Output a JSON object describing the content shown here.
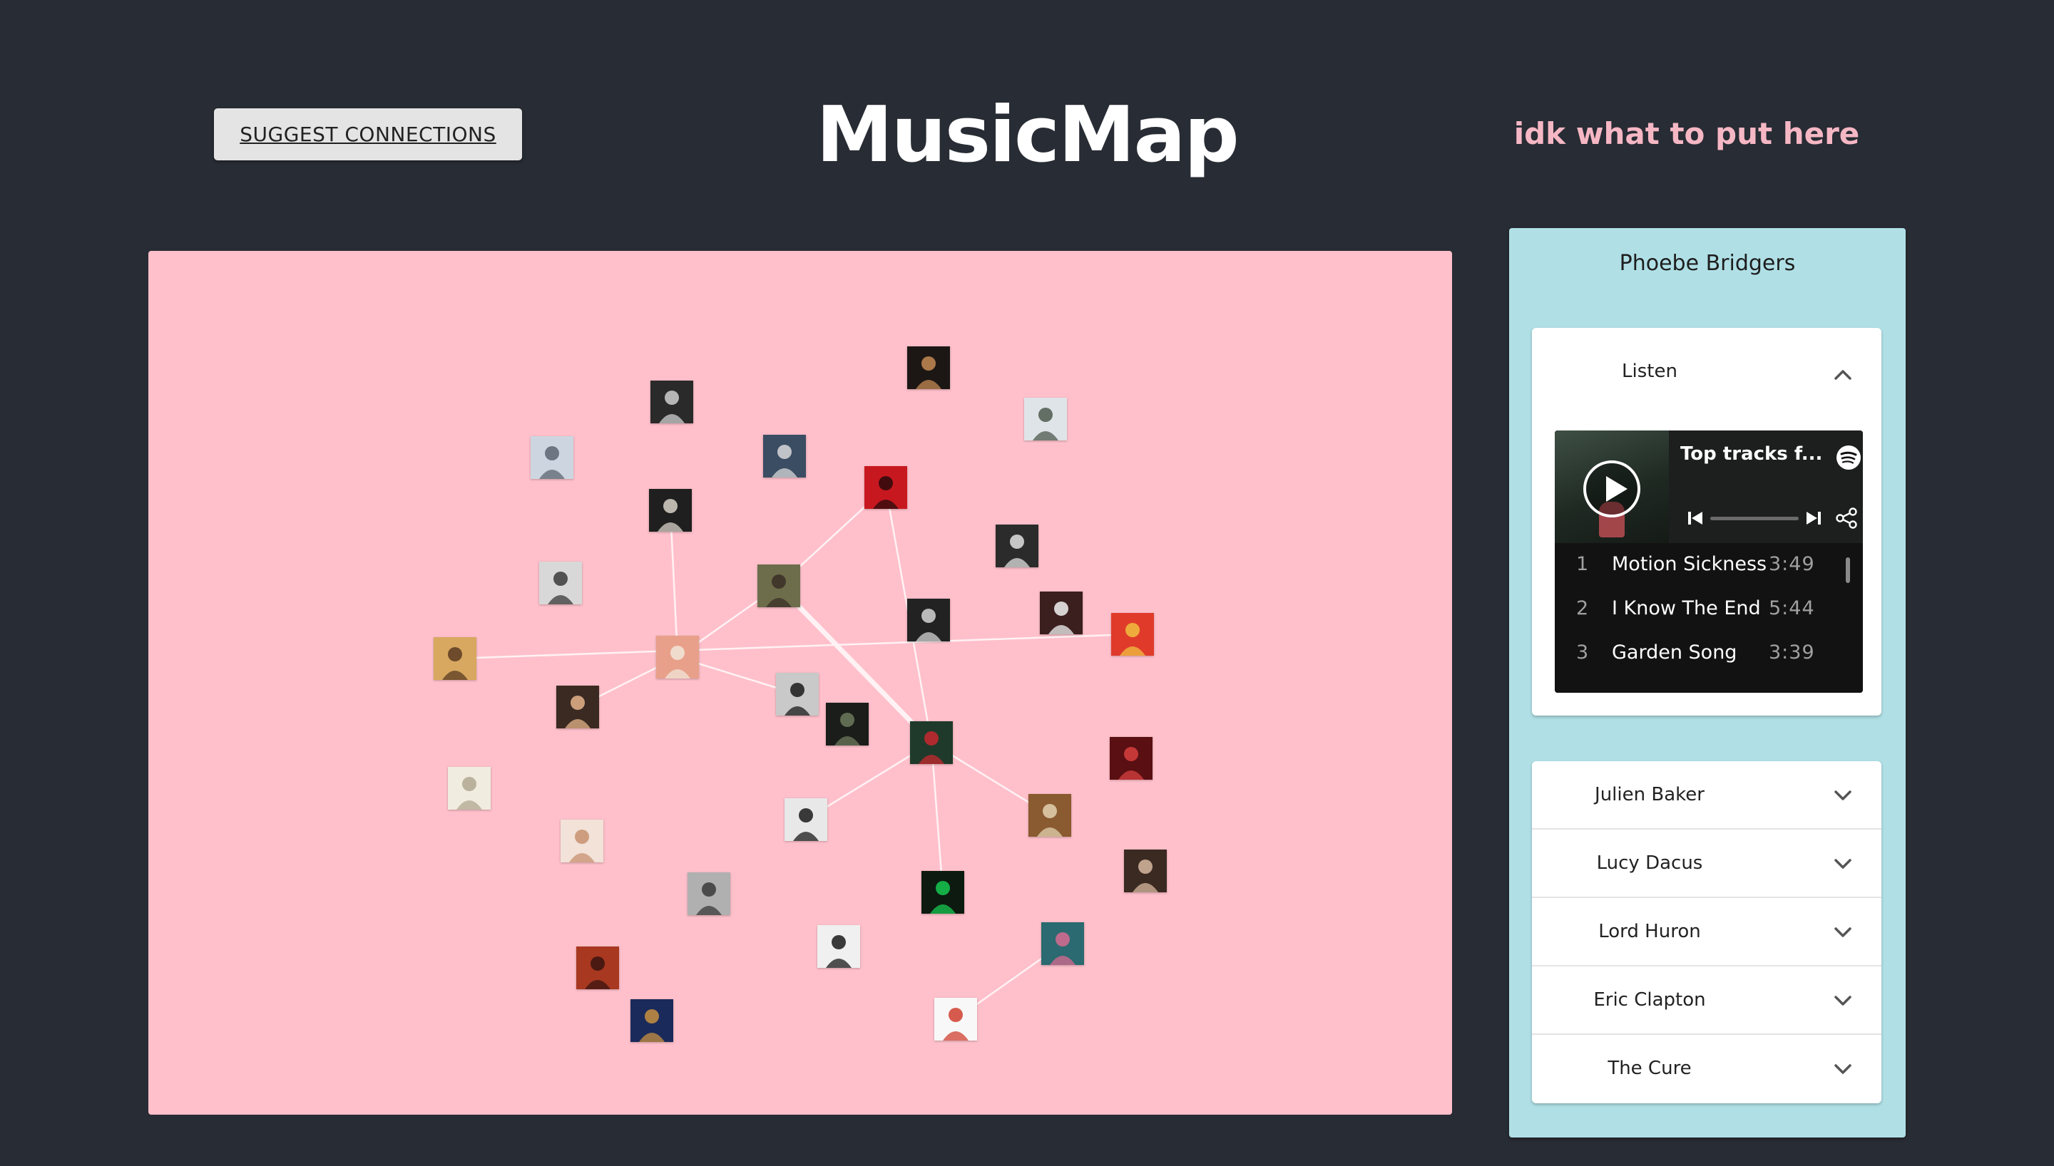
{
  "header": {
    "suggest_button": "SUGGEST CONNECTIONS",
    "title": "MusicMap",
    "note": "idk what to put here"
  },
  "colors": {
    "background": "#282c34",
    "canvas": "#ffc0cb",
    "panel": "#b0e0e6",
    "note": "#f6b7c4",
    "edge": "#fff2f4"
  },
  "panel": {
    "selected_artist": "Phoebe Bridgers",
    "listen_label": "Listen",
    "player": {
      "title": "Top tracks f...",
      "tracks": [
        {
          "num": "1",
          "name": "Motion Sickness",
          "duration": "3:49"
        },
        {
          "num": "2",
          "name": "I Know The End",
          "duration": "5:44"
        },
        {
          "num": "3",
          "name": "Garden Song",
          "duration": "3:39"
        }
      ]
    },
    "related": [
      {
        "name": "Julien Baker"
      },
      {
        "name": "Lucy Dacus"
      },
      {
        "name": "Lord Huron"
      },
      {
        "name": "Eric Clapton"
      },
      {
        "name": "The Cure"
      }
    ]
  },
  "graph": {
    "nodes": [
      {
        "id": "n1",
        "bg": "#2a2a2a",
        "fg": "#cfcfcf",
        "selected": false
      },
      {
        "id": "n2",
        "bg": "#1c1715",
        "fg": "#c48a52",
        "selected": false
      },
      {
        "id": "n3",
        "bg": "#3b4d63",
        "fg": "#d8d8d8",
        "selected": false
      },
      {
        "id": "n4",
        "bg": "#cdd6e0",
        "fg": "#5b6470",
        "selected": false
      },
      {
        "id": "n5",
        "bg": "#dfe4e8",
        "fg": "#4d5a4d",
        "selected": false
      },
      {
        "id": "n6",
        "bg": "#1f1f1f",
        "fg": "#d8d2c8",
        "selected": false
      },
      {
        "id": "n7",
        "bg": "#c8181f",
        "fg": "#2a0b0c",
        "selected": false
      },
      {
        "id": "n8",
        "bg": "#2b2b2b",
        "fg": "#e0e0e0",
        "selected": false
      },
      {
        "id": "n9",
        "bg": "#d8d8d8",
        "fg": "#3a3a3a",
        "selected": false
      },
      {
        "id": "n10",
        "bg": "#6d6d4b",
        "fg": "#3a2f26",
        "selected": false
      },
      {
        "id": "n11",
        "bg": "#3b1e1e",
        "fg": "#f2f2f2",
        "selected": false
      },
      {
        "id": "n12",
        "bg": "#222222",
        "fg": "#d4d4d4",
        "selected": false
      },
      {
        "id": "n13",
        "bg": "#e8a08a",
        "fg": "#f1e6d8",
        "selected": false
      },
      {
        "id": "n14",
        "bg": "#d8a860",
        "fg": "#5b3b22",
        "selected": false
      },
      {
        "id": "n15",
        "bg": "#3a2a22",
        "fg": "#e6b48a",
        "selected": false
      },
      {
        "id": "n16",
        "bg": "#c9c9c9",
        "fg": "#1a1a1a",
        "selected": false
      },
      {
        "id": "n17",
        "bg": "#e03b2a",
        "fg": "#f0c040",
        "selected": false
      },
      {
        "id": "n18",
        "bg": "#1a1d1a",
        "fg": "#6d7a5c",
        "selected": false
      },
      {
        "id": "n19",
        "bg": "#1f3a2a",
        "fg": "#c8282f",
        "selected": true
      },
      {
        "id": "n20",
        "bg": "#5a0f12",
        "fg": "#d84040",
        "selected": false
      },
      {
        "id": "n21",
        "bg": "#f1ece0",
        "fg": "#b0a890",
        "selected": false
      },
      {
        "id": "n22",
        "bg": "#8a5a30",
        "fg": "#e2d1b0",
        "selected": false
      },
      {
        "id": "n23",
        "bg": "#e8e8e8",
        "fg": "#1a1a1a",
        "selected": false
      },
      {
        "id": "n24",
        "bg": "#f2e2d8",
        "fg": "#c89070",
        "selected": false
      },
      {
        "id": "n25",
        "bg": "#0d1a10",
        "fg": "#18c850",
        "selected": false
      },
      {
        "id": "n26",
        "bg": "#3a2a22",
        "fg": "#d8b8a0",
        "selected": false
      },
      {
        "id": "n27",
        "bg": "#b0b0b0",
        "fg": "#3a3a3a",
        "selected": false
      },
      {
        "id": "n28",
        "bg": "#2a6a70",
        "fg": "#d86a90",
        "selected": false
      },
      {
        "id": "n29",
        "bg": "#f0f0f0",
        "fg": "#1a1a1a",
        "selected": false
      },
      {
        "id": "n30",
        "bg": "#a83820",
        "fg": "#3a1410",
        "selected": false
      },
      {
        "id": "n31",
        "bg": "#f8f8f8",
        "fg": "#d04030",
        "selected": false
      },
      {
        "id": "n32",
        "bg": "#1a2a5a",
        "fg": "#c89040",
        "selected": false
      }
    ],
    "edges": [
      {
        "from": "n13",
        "to": "n15"
      },
      {
        "from": "n13",
        "to": "n10"
      },
      {
        "from": "n13",
        "to": "n6"
      },
      {
        "from": "n13",
        "to": "n16"
      },
      {
        "from": "n10",
        "to": "n7"
      },
      {
        "from": "n10",
        "to": "n19"
      },
      {
        "from": "n7",
        "to": "n19"
      },
      {
        "from": "n14",
        "to": "n17"
      },
      {
        "from": "n19",
        "to": "n22"
      },
      {
        "from": "n19",
        "to": "n23"
      },
      {
        "from": "n19",
        "to": "n25"
      },
      {
        "from": "n28",
        "to": "n31"
      }
    ]
  }
}
